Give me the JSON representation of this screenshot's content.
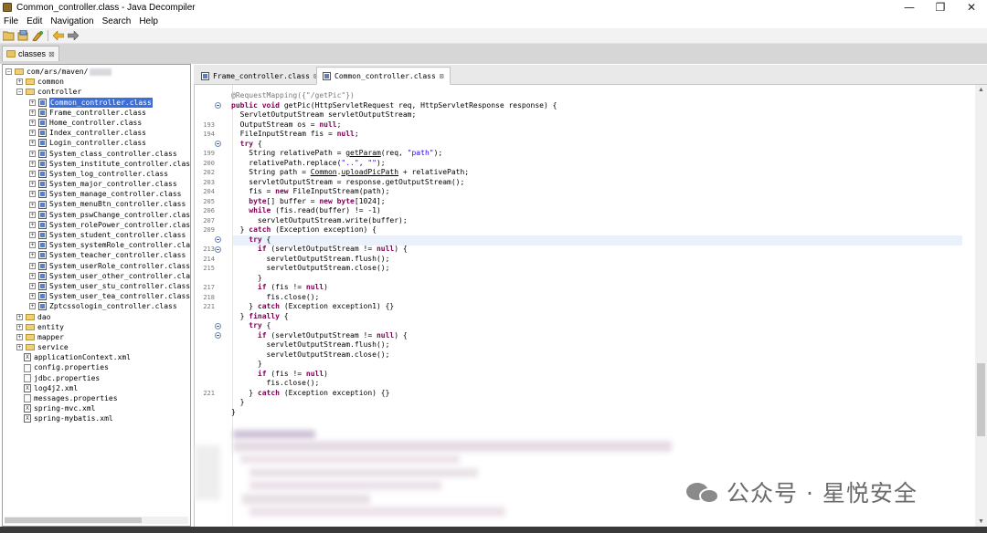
{
  "window": {
    "title": "Common_controller.class - Java Decompiler",
    "minimize_glyph": "—",
    "maximize_glyph": "❐",
    "close_glyph": "✕"
  },
  "menu": [
    "File",
    "Edit",
    "Navigation",
    "Search",
    "Help"
  ],
  "toolbar_icons": [
    "open-file-icon",
    "open-type-icon",
    "search-icon",
    "back-arrow-icon",
    "forward-arrow-icon"
  ],
  "top_tab": {
    "label": "classes"
  },
  "tree": {
    "root": "com/ars/maven/",
    "items": [
      {
        "label": "common",
        "kind": "folder",
        "level": 1
      },
      {
        "label": "controller",
        "kind": "folder",
        "level": 1,
        "expanded": true
      },
      {
        "label": "Common_controller.class",
        "kind": "class",
        "level": 2,
        "selected": true
      },
      {
        "label": "Frame_controller.class",
        "kind": "class",
        "level": 2
      },
      {
        "label": "Home_controller.class",
        "kind": "class",
        "level": 2
      },
      {
        "label": "Index_controller.class",
        "kind": "class",
        "level": 2
      },
      {
        "label": "Login_controller.class",
        "kind": "class",
        "level": 2
      },
      {
        "label": "System_class_controller.class",
        "kind": "class",
        "level": 2
      },
      {
        "label": "System_institute_controller.class",
        "kind": "class",
        "level": 2
      },
      {
        "label": "System_log_controller.class",
        "kind": "class",
        "level": 2
      },
      {
        "label": "System_major_controller.class",
        "kind": "class",
        "level": 2
      },
      {
        "label": "System_manage_controller.class",
        "kind": "class",
        "level": 2
      },
      {
        "label": "System_menuBtn_controller.class",
        "kind": "class",
        "level": 2
      },
      {
        "label": "System_pswChange_controller.class",
        "kind": "class",
        "level": 2
      },
      {
        "label": "System_rolePower_controller.class",
        "kind": "class",
        "level": 2
      },
      {
        "label": "System_student_controller.class",
        "kind": "class",
        "level": 2
      },
      {
        "label": "System_systemRole_controller.clas",
        "kind": "class",
        "level": 2
      },
      {
        "label": "System_teacher_controller.class",
        "kind": "class",
        "level": 2
      },
      {
        "label": "System_userRole_controller.class",
        "kind": "class",
        "level": 2
      },
      {
        "label": "System_user_other_controller.clas",
        "kind": "class",
        "level": 2
      },
      {
        "label": "System_user_stu_controller.class",
        "kind": "class",
        "level": 2
      },
      {
        "label": "System_user_tea_controller.class",
        "kind": "class",
        "level": 2
      },
      {
        "label": "Zptcssologin_controller.class",
        "kind": "class",
        "level": 2
      },
      {
        "label": "dao",
        "kind": "folder",
        "level": 1
      },
      {
        "label": "entity",
        "kind": "folder",
        "level": 1
      },
      {
        "label": "mapper",
        "kind": "folder",
        "level": 1
      },
      {
        "label": "service",
        "kind": "folder",
        "level": 1
      },
      {
        "label": "applicationContext.xml",
        "kind": "xml",
        "level": 0
      },
      {
        "label": "config.properties",
        "kind": "props",
        "level": 0
      },
      {
        "label": "jdbc.properties",
        "kind": "props",
        "level": 0
      },
      {
        "label": "log4j2.xml",
        "kind": "xml",
        "level": 0
      },
      {
        "label": "messages.properties",
        "kind": "props",
        "level": 0
      },
      {
        "label": "spring-mvc.xml",
        "kind": "xml",
        "level": 0
      },
      {
        "label": "spring-mybatis.xml",
        "kind": "xml",
        "level": 0
      }
    ]
  },
  "editor_tabs": [
    {
      "label": "Frame_controller.class",
      "active": false
    },
    {
      "label": "Common_controller.class",
      "active": true
    }
  ],
  "code_lines": [
    {
      "n": "",
      "fold": false,
      "t": "<span class=\"an\">@RequestMapping({\"/getPic\"})</span>"
    },
    {
      "n": "",
      "fold": true,
      "t": "<span class=\"kw\">public</span> <span class=\"kw\">void</span> getPic(HttpServletRequest req, HttpServletResponse response) {"
    },
    {
      "n": "",
      "fold": false,
      "t": "  ServletOutputStream servletOutputStream;"
    },
    {
      "n": "193",
      "fold": false,
      "t": "  OutputStream os = <span class=\"kw\">null</span>;"
    },
    {
      "n": "194",
      "fold": false,
      "t": "  FileInputStream fis = <span class=\"kw\">null</span>;"
    },
    {
      "n": "",
      "fold": true,
      "t": "  <span class=\"kw\">try</span> {"
    },
    {
      "n": "199",
      "fold": false,
      "t": "    String relativePath = <span class=\"ul\">getParam</span>(req, <span class=\"st\">\"path\"</span>);"
    },
    {
      "n": "200",
      "fold": false,
      "t": "    relativePath.replace(<span class=\"st\">\"..\"</span>, <span class=\"st\">\"\"</span>);"
    },
    {
      "n": "202",
      "fold": false,
      "t": "    String path = <span class=\"ul\">Common</span>.<span class=\"ul\">uploadPicPath</span> + relativePath;"
    },
    {
      "n": "203",
      "fold": false,
      "t": "    servletOutputStream = response.getOutputStream();"
    },
    {
      "n": "204",
      "fold": false,
      "t": "    fis = <span class=\"kw\">new</span> FileInputStream(path);"
    },
    {
      "n": "205",
      "fold": false,
      "t": "    <span class=\"kw\">byte</span>[] buffer = <span class=\"kw\">new</span> <span class=\"kw\">byte</span>[1024];"
    },
    {
      "n": "206",
      "fold": false,
      "t": "    <span class=\"kw\">while</span> (fis.read(buffer) != -1)"
    },
    {
      "n": "207",
      "fold": false,
      "t": "      servletOutputStream.write(buffer);"
    },
    {
      "n": "209",
      "fold": false,
      "t": "  } <span class=\"kw\">catch</span> (Exception exception) {"
    },
    {
      "n": "",
      "fold": true,
      "t": "    <span class=\"kw\">try</span> {"
    },
    {
      "n": "213",
      "fold": true,
      "t": "      <span class=\"kw\">if</span> (servletOutputStream != <span class=\"kw\">null</span>) {"
    },
    {
      "n": "214",
      "fold": false,
      "t": "        servletOutputStream.flush();"
    },
    {
      "n": "215",
      "fold": false,
      "t": "        servletOutputStream.close();"
    },
    {
      "n": "",
      "fold": false,
      "t": "      }"
    },
    {
      "n": "217",
      "fold": false,
      "t": "      <span class=\"kw\">if</span> (fis != <span class=\"kw\">null</span>)"
    },
    {
      "n": "218",
      "fold": false,
      "t": "        fis.close();"
    },
    {
      "n": "221",
      "fold": false,
      "t": "    } <span class=\"kw\">catch</span> (Exception exception1) {}"
    },
    {
      "n": "",
      "fold": false,
      "t": "  } <span class=\"kw\">finally</span> {"
    },
    {
      "n": "",
      "fold": true,
      "t": "    <span class=\"kw\">try</span> {"
    },
    {
      "n": "",
      "fold": true,
      "t": "      <span class=\"kw\">if</span> (servletOutputStream != <span class=\"kw\">null</span>) {"
    },
    {
      "n": "",
      "fold": false,
      "t": "        servletOutputStream.flush();"
    },
    {
      "n": "",
      "fold": false,
      "t": "        servletOutputStream.close();"
    },
    {
      "n": "",
      "fold": false,
      "t": "      }"
    },
    {
      "n": "",
      "fold": false,
      "t": "      <span class=\"kw\">if</span> (fis != <span class=\"kw\">null</span>)"
    },
    {
      "n": "",
      "fold": false,
      "t": "        fis.close();"
    },
    {
      "n": "221",
      "fold": false,
      "t": "    } <span class=\"kw\">catch</span> (Exception exception) {}"
    },
    {
      "n": "",
      "fold": false,
      "t": "  }"
    },
    {
      "n": "",
      "fold": false,
      "t": "}"
    }
  ],
  "highlighted_line": 15,
  "watermark": {
    "text": "公众号 · 星悦安全",
    "icon": "wechat-logo-icon"
  },
  "colors": {
    "selection": "#3d6fd8",
    "keyword": "#7f0055",
    "string": "#2a00ff",
    "current_line": "#eaf1fb"
  }
}
